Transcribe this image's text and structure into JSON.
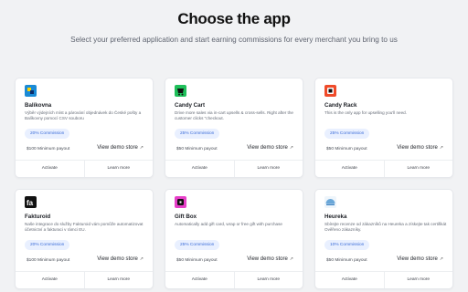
{
  "header": {
    "title": "Choose the app",
    "subtitle": "Select your preferred application and start earning commissions for every merchant you bring to us"
  },
  "colors": {
    "badge_bg": "#e9f0ff",
    "badge_text": "#3a6bd8",
    "page_bg": "#f1f2f4"
  },
  "apps": [
    {
      "name": "Balíkovna",
      "icon": "balikovna-logo-icon",
      "logo_color": "#1b8bd6",
      "description": "Výběr výdejních míst a párování objednávek do České pošty a Balíkovny pomocí CSV souboru",
      "commission": "20% Commission",
      "payout": "$100 Minimum payout",
      "demo": "View demo store",
      "activate": "Activate",
      "learn": "Learn more"
    },
    {
      "name": "Candy Cart",
      "icon": "candy-cart-logo-icon",
      "logo_color": "#1fbf5a",
      "description": "Drive more sales via in-cart upsells & cross-sells. Right after the customer clicks \"checkout.",
      "commission": "25% Commission",
      "payout": "$50 Minimum payout",
      "demo": "View demo store",
      "activate": "Activate",
      "learn": "Learn more"
    },
    {
      "name": "Candy Rack",
      "icon": "candy-rack-logo-icon",
      "logo_color": "#ef4b2a",
      "description": "This is the only app for upselling you'll need.",
      "commission": "25% Commission",
      "payout": "$50 Minimum payout",
      "demo": "View demo store",
      "activate": "Activate",
      "learn": "Learn more"
    },
    {
      "name": "Fakturoid",
      "icon": "fakturoid-logo-icon",
      "logo_color": "#111111",
      "description": "Naše integrace do služby Fakturoid vám pomůže automatizovat účetnictví a fakturaci v rámci EU.",
      "commission": "20% Commission",
      "payout": "$100 Minimum payout",
      "demo": "View demo store",
      "activate": "Activate",
      "learn": "Learn more"
    },
    {
      "name": "Gift Box",
      "icon": "gift-box-logo-icon",
      "logo_color": "#e640c8",
      "description": "Automatically add gift card, wrap or free gift with purchase",
      "commission": "25% Commission",
      "payout": "$50 Minimum payout",
      "demo": "View demo store",
      "activate": "Activate",
      "learn": "Learn more"
    },
    {
      "name": "Heureka",
      "icon": "heureka-logo-icon",
      "logo_color": "#6aa7d8",
      "description": "Sbírejte recenze od zákazníků na Heureka a získejte tak certifikát Ověřeno zákazníky.",
      "commission": "10% Commission",
      "payout": "$50 Minimum payout",
      "demo": "View demo store",
      "activate": "Activate",
      "learn": "Learn more"
    }
  ]
}
